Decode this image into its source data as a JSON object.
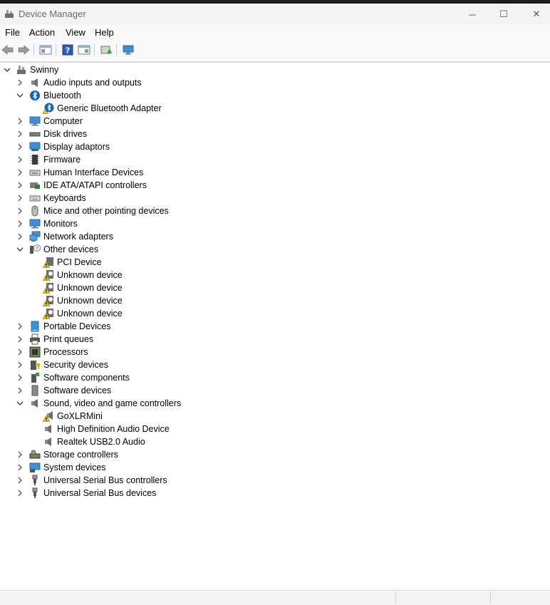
{
  "window": {
    "title": "Device Manager",
    "minimize_glyph": "─",
    "maximize_glyph": "☐",
    "close_glyph": "✕"
  },
  "menubar": {
    "file": "File",
    "action": "Action",
    "view": "View",
    "help": "Help"
  },
  "toolbar": {
    "icons": [
      "back-arrow-icon",
      "forward-arrow-icon",
      "properties-icon",
      "help-icon",
      "console-tree-icon",
      "update-driver-icon",
      "scan-hardware-icon"
    ]
  },
  "tree": {
    "root": "Swinny",
    "audio_inputs_outputs": "Audio inputs and outputs",
    "bluetooth": "Bluetooth",
    "generic_bluetooth_adapter": "Generic Bluetooth Adapter",
    "computer": "Computer",
    "disk_drives": "Disk drives",
    "display_adaptors": "Display adaptors",
    "firmware": "Firmware",
    "human_interface_devices": "Human Interface Devices",
    "ide_ata_atapi": "IDE ATA/ATAPI controllers",
    "keyboards": "Keyboards",
    "mice": "Mice and other pointing devices",
    "monitors": "Monitors",
    "network_adapters": "Network adapters",
    "other_devices": "Other devices",
    "pci_device": "PCI Device",
    "unknown_device_1": "Unknown device",
    "unknown_device_2": "Unknown device",
    "unknown_device_3": "Unknown device",
    "unknown_device_4": "Unknown device",
    "portable_devices": "Portable Devices",
    "print_queues": "Print queues",
    "processors": "Processors",
    "security_devices": "Security devices",
    "software_components": "Software components",
    "software_devices": "Software devices",
    "sound_video_game": "Sound, video and game controllers",
    "goxlr_mini": "GoXLRMini",
    "hd_audio_device": "High Definition Audio Device",
    "realtek_usb_audio": "Realtek USB2.0 Audio",
    "storage_controllers": "Storage controllers",
    "system_devices": "System devices",
    "usb_controllers": "Universal Serial Bus controllers",
    "usb_devices": "Universal Serial Bus devices"
  },
  "colors": {
    "accent_blue": "#0a64c8",
    "warning_yellow": "#f2c200",
    "titlebar_bg": "#f3f3f3"
  }
}
